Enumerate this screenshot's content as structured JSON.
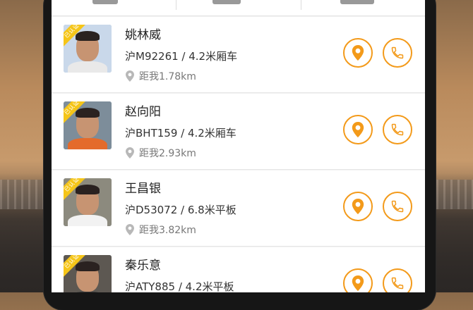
{
  "drivers": [
    {
      "name": "姚林威",
      "vehicle": "沪M92261 / 4.2米厢车",
      "distance": "距我1.78km",
      "badge": "已认证",
      "photo_bg": "#c9d8ea",
      "photo_shirt": "#e9e9e9"
    },
    {
      "name": "赵向阳",
      "vehicle": "沪BHT159 / 4.2米厢车",
      "distance": "距我2.93km",
      "badge": "已认证",
      "photo_bg": "#7d8d9a",
      "photo_shirt": "#e46b2b"
    },
    {
      "name": "王昌银",
      "vehicle": "沪D53072 / 6.8米平板",
      "distance": "距我3.82km",
      "badge": "已认证",
      "photo_bg": "#8c8a7e",
      "photo_shirt": "#f2f2f2"
    },
    {
      "name": "秦乐意",
      "vehicle": "沪ATY885 / 4.2米平板",
      "distance": "",
      "badge": "已认证",
      "photo_bg": "#5d5852",
      "photo_shirt": "#3b3b3b"
    }
  ],
  "colors": {
    "accent": "#f39a1a",
    "badge": "#f5c518"
  },
  "icons": {
    "location": "location-pin-icon",
    "call": "phone-icon",
    "distance": "map-pin-icon"
  }
}
